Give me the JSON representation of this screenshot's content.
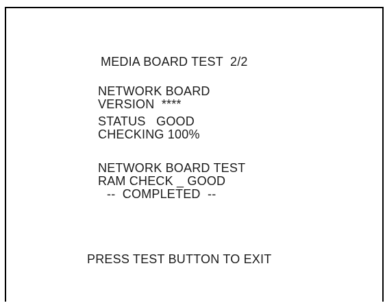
{
  "screen": {
    "title": "MEDIA BOARD TEST  2/2",
    "network_board": {
      "label": "NETWORK BOARD",
      "version": "VERSION  ****",
      "status": "STATUS   GOOD",
      "checking": "CHECKING 100%"
    },
    "network_board_test": {
      "label": "NETWORK BOARD TEST",
      "ram_check": "RAM CHECK _ GOOD",
      "completed": "--  COMPLETED  --"
    },
    "footer": {
      "exit_message": "PRESS TEST BUTTON TO EXIT"
    }
  },
  "colors": {
    "background": "#ffffff",
    "text": "#1a1a1a",
    "border": "#000000"
  }
}
